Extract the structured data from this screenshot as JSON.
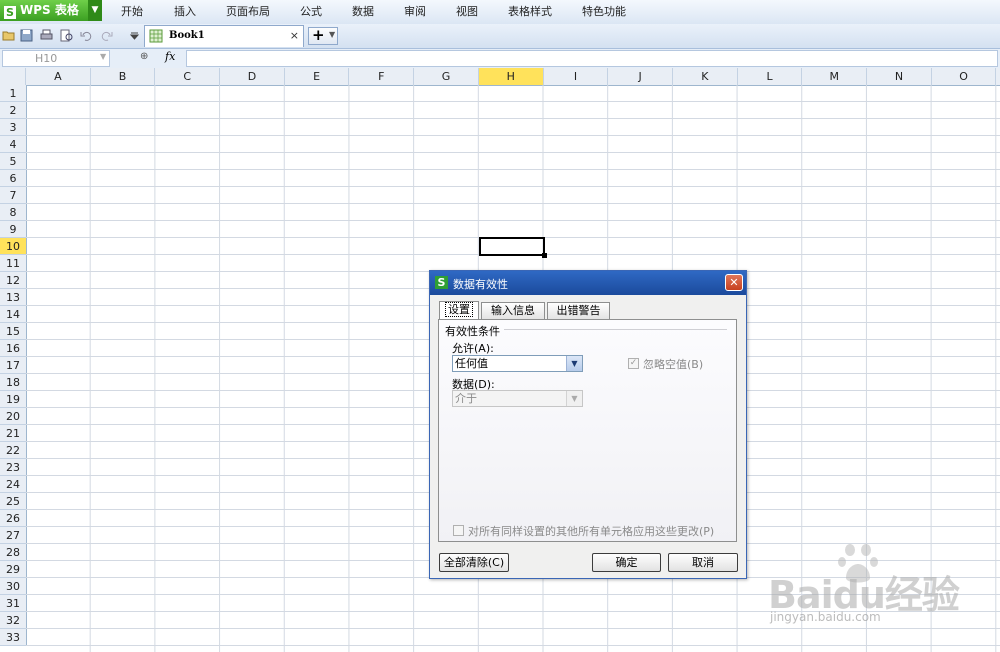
{
  "app": {
    "name": "WPS 表格",
    "logo_letter": "S"
  },
  "menu": [
    "开始",
    "插入",
    "页面布局",
    "公式",
    "数据",
    "审阅",
    "视图",
    "表格样式",
    "特色功能"
  ],
  "tabs": {
    "book_label": "Book1",
    "close": "×",
    "new_tab": "+"
  },
  "formula_bar": {
    "name_box": "H10",
    "fx": "fx",
    "zoom_icon": "⊕"
  },
  "grid": {
    "columns": [
      "A",
      "B",
      "C",
      "D",
      "E",
      "F",
      "G",
      "H",
      "I",
      "J",
      "K",
      "L",
      "M",
      "N",
      "O"
    ],
    "rows": [
      "1",
      "2",
      "3",
      "4",
      "5",
      "6",
      "7",
      "8",
      "9",
      "10",
      "11",
      "12",
      "13",
      "14",
      "15",
      "16",
      "17",
      "18",
      "19",
      "20",
      "21",
      "22",
      "23",
      "24",
      "25",
      "26",
      "27",
      "28",
      "29",
      "30",
      "31",
      "32",
      "33"
    ],
    "active_column": "H",
    "active_row": "10"
  },
  "dialog": {
    "title": "数据有效性",
    "close": "✕",
    "tabs": [
      "设置",
      "输入信息",
      "出错警告"
    ],
    "active_tab": "设置",
    "group_label": "有效性条件",
    "allow_label": "允许(A):",
    "allow_value": "任何值",
    "ignore_blank_label": "忽略空值(B)",
    "ignore_blank_checked": true,
    "data_label": "数据(D):",
    "data_value": "介于",
    "apply_all_label": "对所有同样设置的其他所有单元格应用这些更改(P)",
    "apply_all_checked": false,
    "clear_all_button": "全部清除(C)",
    "ok_button": "确定",
    "cancel_button": "取消"
  },
  "watermark": {
    "logo": "Baidu经验",
    "url": "jingyan.baidu.com"
  }
}
